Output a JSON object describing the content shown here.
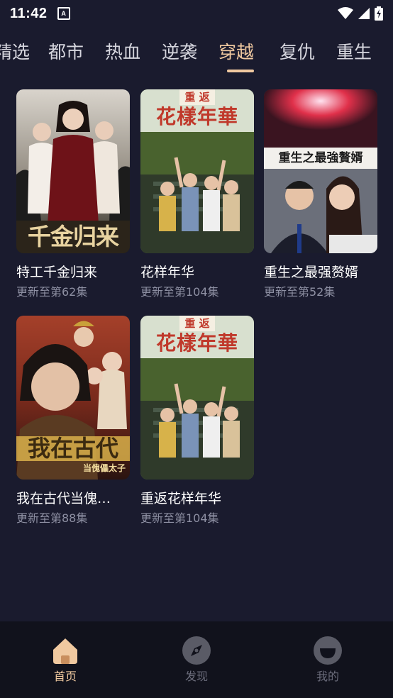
{
  "status_bar": {
    "time": "11:42",
    "app_icon_letter": "A"
  },
  "tabs": [
    {
      "label": "精选",
      "active": false
    },
    {
      "label": "都市",
      "active": false
    },
    {
      "label": "热血",
      "active": false
    },
    {
      "label": "逆袭",
      "active": false
    },
    {
      "label": "穿越",
      "active": true
    },
    {
      "label": "复仇",
      "active": false
    },
    {
      "label": "重生",
      "active": false
    }
  ],
  "dramas": [
    {
      "title": "特工千金归来",
      "episodes": "更新至第62集",
      "cover_text": "千金归来"
    },
    {
      "title": "花样年华",
      "episodes": "更新至第104集",
      "cover_text": "花樣年華",
      "cover_top": "重 返"
    },
    {
      "title": "重生之最强赘婿",
      "episodes": "更新至第52集",
      "cover_text": "重生之最強贅婿"
    },
    {
      "title": "我在古代当傀…",
      "episodes": "更新至第88集",
      "cover_text": "我在古代",
      "cover_sub": "当傀儡太子"
    },
    {
      "title": "重返花样年华",
      "episodes": "更新至第104集",
      "cover_text": "花樣年華",
      "cover_top": "重 返"
    }
  ],
  "bottom_nav": [
    {
      "label": "首页",
      "icon": "home-icon",
      "active": true
    },
    {
      "label": "发现",
      "icon": "compass-icon",
      "active": false
    },
    {
      "label": "我的",
      "icon": "profile-icon",
      "active": false
    }
  ],
  "colors": {
    "background": "#1a1b2e",
    "accent": "#f0c9a0",
    "secondary_text": "#8e90a3",
    "nav_background": "#11121c"
  }
}
